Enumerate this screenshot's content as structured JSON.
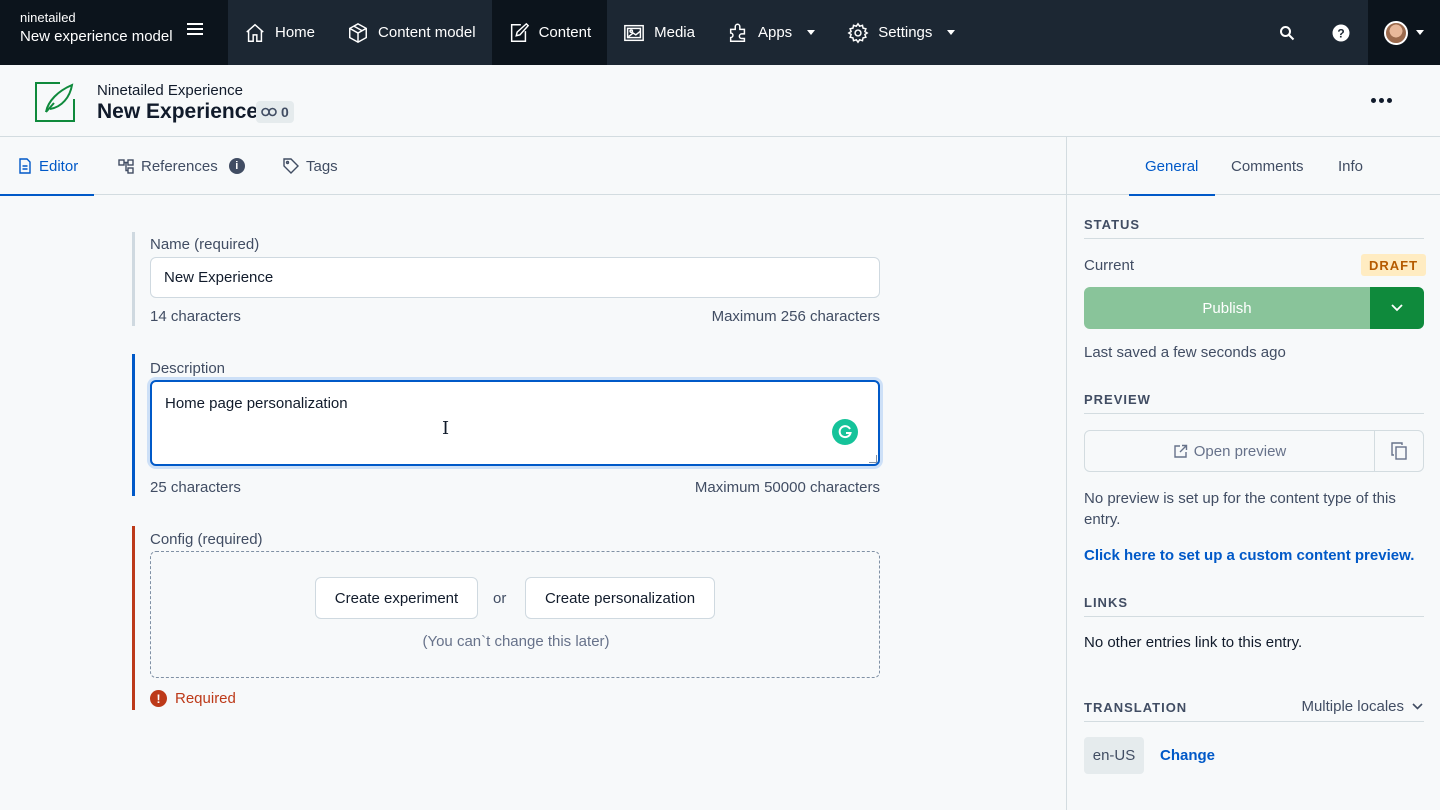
{
  "topnav": {
    "org": "ninetailed",
    "space_name": "New experience model",
    "items": [
      {
        "label": "Home",
        "icon": "home-icon"
      },
      {
        "label": "Content model",
        "icon": "content-model-icon"
      },
      {
        "label": "Content",
        "icon": "content-icon"
      },
      {
        "label": "Media",
        "icon": "media-icon"
      },
      {
        "label": "Apps",
        "icon": "apps-icon"
      },
      {
        "label": "Settings",
        "icon": "settings-icon"
      }
    ]
  },
  "entity": {
    "content_type": "Ninetailed Experience",
    "title": "New Experience",
    "references_count": "0"
  },
  "editor_tabs": {
    "editor": "Editor",
    "references": "References",
    "references_info": "i",
    "tags": "Tags"
  },
  "fields": {
    "name": {
      "label": "Name (required)",
      "value": "New Experience",
      "count": "14 characters",
      "max": "Maximum 256 characters"
    },
    "description": {
      "label": "Description",
      "value": "Home page personalization",
      "count": "25 characters",
      "max": "Maximum 50000 characters"
    },
    "config": {
      "label": "Config (required)",
      "create_experiment": "Create experiment",
      "or": "or",
      "create_personalization": "Create personalization",
      "note": "(You can`t change this later)",
      "error": "Required",
      "error_icon": "!"
    }
  },
  "sidebar": {
    "tabs": [
      "General",
      "Comments",
      "Info"
    ],
    "status": {
      "heading": "STATUS",
      "current_label": "Current",
      "badge": "DRAFT",
      "publish": "Publish",
      "last_saved": "Last saved a few seconds ago"
    },
    "preview": {
      "heading": "PREVIEW",
      "open": "Open preview",
      "message_line1": "No preview is set up for the content type of this",
      "message_line2": "entry.",
      "setup_link": "Click here to set up a custom content preview."
    },
    "links": {
      "heading": "LINKS",
      "message": "No other entries link to this entry."
    },
    "translation": {
      "heading": "TRANSLATION",
      "mode": "Multiple locales",
      "locale": "en-US",
      "change": "Change"
    }
  },
  "colors": {
    "nav_bg": "#1c2733",
    "nav_active": "#0c141c",
    "accent": "#0059c8",
    "publish": "#89c49a",
    "publish_dropdown": "#0f8a3c",
    "error": "#bd3a19",
    "draft_bg": "#ffecc2",
    "draft_text": "#b55b00"
  }
}
